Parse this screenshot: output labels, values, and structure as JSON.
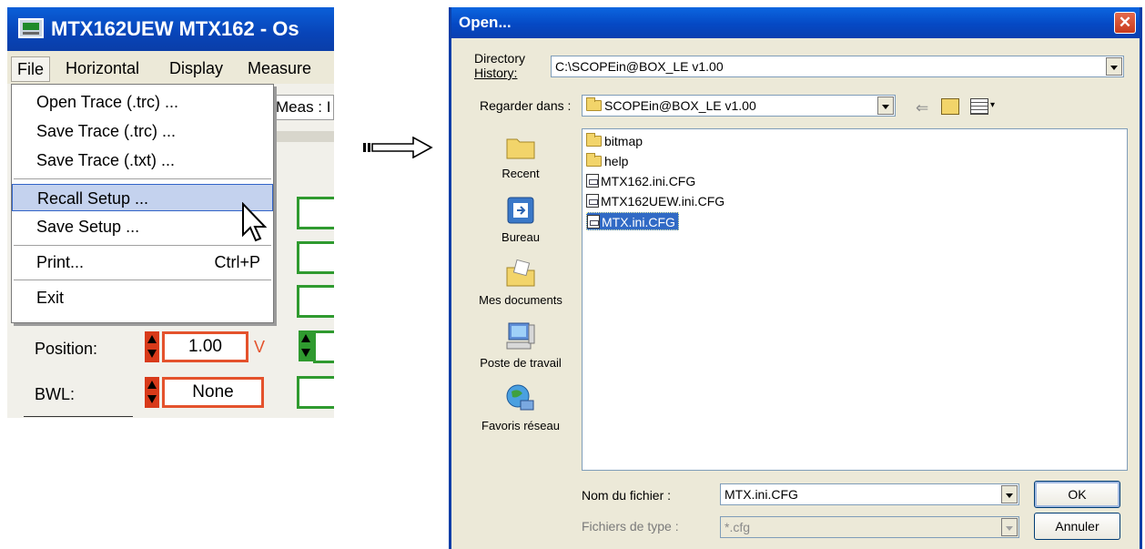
{
  "app": {
    "title": "MTX162UEW MTX162 - Os",
    "menu": [
      "File",
      "Horizontal",
      "Display",
      "Measure"
    ],
    "meas_label": "Meas : I",
    "file_menu": [
      {
        "label": "Open Trace (.trc) ...",
        "shortcut": ""
      },
      {
        "label": "Save Trace (.trc) ...",
        "shortcut": ""
      },
      {
        "label": "Save Trace (.txt) ...",
        "shortcut": ""
      },
      {
        "label": "Recall Setup ...",
        "shortcut": ""
      },
      {
        "label": "Save Setup ...",
        "shortcut": ""
      },
      {
        "label": "Print...",
        "shortcut": "Ctrl+P"
      },
      {
        "label": "Exit",
        "shortcut": ""
      }
    ],
    "highlighted_item": "Recall Setup ...",
    "position_label": "Position:",
    "position_value": "1.00",
    "position_unit": "V",
    "bwl_label": "BWL:",
    "bwl_value": "None"
  },
  "dialog": {
    "title": "Open...",
    "close_glyph": "✕",
    "history_label_1": "Directory",
    "history_label_2": "History:",
    "history_value": "C:\\SCOPEin@BOX_LE v1.00",
    "lookin_label": "Regarder dans :",
    "lookin_value": "SCOPEin@BOX_LE v1.00",
    "places": [
      "Recent",
      "Bureau",
      "Mes documents",
      "Poste de travail",
      "Favoris réseau"
    ],
    "files": [
      {
        "name": "bitmap",
        "kind": "folder"
      },
      {
        "name": "help",
        "kind": "folder"
      },
      {
        "name": "MTX162.ini.CFG",
        "kind": "file"
      },
      {
        "name": "MTX162UEW.ini.CFG",
        "kind": "file"
      },
      {
        "name": "MTX.ini.CFG",
        "kind": "file"
      }
    ],
    "selected_file": "MTX.ini.CFG",
    "filename_label": "Nom du fichier :",
    "filename_value": "MTX.ini.CFG",
    "filetype_label": "Fichiers de type :",
    "filetype_value": "*.cfg",
    "ok_label": "OK",
    "cancel_label": "Annuler"
  },
  "colors": {
    "titlebar_blue": "#0a4fc8",
    "menu_highlight": "#c4d2ee",
    "spin_red": "#d83a1a",
    "spin_green": "#2f9a2f",
    "selection_blue": "#316ac5"
  }
}
